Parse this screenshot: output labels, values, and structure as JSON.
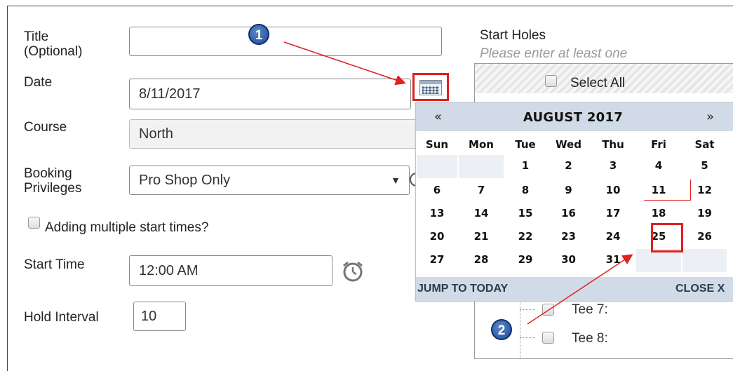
{
  "form": {
    "title_label": "Title\n(Optional)",
    "title_value": "",
    "date_label": "Date",
    "date_value": "8/11/2017",
    "course_label": "Course",
    "course_value": "North",
    "booking_label": "Booking\nPrivileges",
    "booking_value": "Pro Shop Only",
    "multi_label": "Adding multiple start times?",
    "start_time_label": "Start Time",
    "start_time_value": "12:00 AM",
    "hold_interval_label": "Hold Interval",
    "hold_interval_value": "10"
  },
  "holes": {
    "label": "Start Holes",
    "hint": "Please enter at least one",
    "select_all": "Select All",
    "tees": [
      "Tee 7:",
      "Tee 8:"
    ]
  },
  "calendar": {
    "prev": "«",
    "next": "»",
    "title": "AUGUST 2017",
    "weekdays": [
      "Sun",
      "Mon",
      "Tue",
      "Wed",
      "Thu",
      "Fri",
      "Sat"
    ],
    "days": [
      "",
      "",
      "1",
      "2",
      "3",
      "4",
      "5",
      "6",
      "7",
      "8",
      "9",
      "10",
      "11",
      "12",
      "13",
      "14",
      "15",
      "16",
      "17",
      "18",
      "19",
      "20",
      "21",
      "22",
      "23",
      "24",
      "25",
      "26",
      "27",
      "28",
      "29",
      "30",
      "31",
      "",
      ""
    ],
    "jump_today": "JUMP TO TODAY",
    "close": "CLOSE X"
  },
  "annotations": {
    "badge1": "1",
    "badge2": "2"
  },
  "colors": {
    "highlight": "#e02020",
    "calendar_header": "#d1dbe7",
    "badge": "#2a5aa8"
  }
}
